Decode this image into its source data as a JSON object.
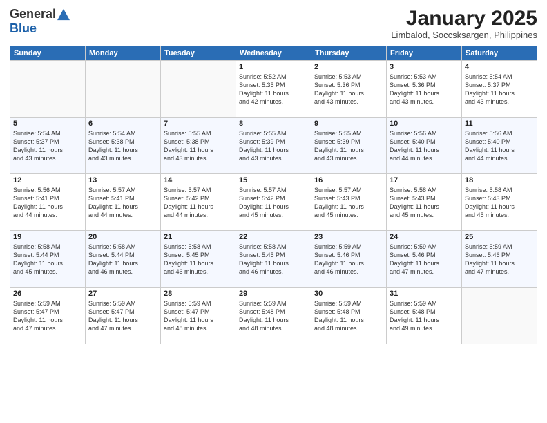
{
  "logo": {
    "general": "General",
    "blue": "Blue"
  },
  "title": "January 2025",
  "location": "Limbalod, Soccsksargen, Philippines",
  "headers": [
    "Sunday",
    "Monday",
    "Tuesday",
    "Wednesday",
    "Thursday",
    "Friday",
    "Saturday"
  ],
  "weeks": [
    [
      {
        "day": "",
        "info": ""
      },
      {
        "day": "",
        "info": ""
      },
      {
        "day": "",
        "info": ""
      },
      {
        "day": "1",
        "info": "Sunrise: 5:52 AM\nSunset: 5:35 PM\nDaylight: 11 hours\nand 42 minutes."
      },
      {
        "day": "2",
        "info": "Sunrise: 5:53 AM\nSunset: 5:36 PM\nDaylight: 11 hours\nand 43 minutes."
      },
      {
        "day": "3",
        "info": "Sunrise: 5:53 AM\nSunset: 5:36 PM\nDaylight: 11 hours\nand 43 minutes."
      },
      {
        "day": "4",
        "info": "Sunrise: 5:54 AM\nSunset: 5:37 PM\nDaylight: 11 hours\nand 43 minutes."
      }
    ],
    [
      {
        "day": "5",
        "info": "Sunrise: 5:54 AM\nSunset: 5:37 PM\nDaylight: 11 hours\nand 43 minutes."
      },
      {
        "day": "6",
        "info": "Sunrise: 5:54 AM\nSunset: 5:38 PM\nDaylight: 11 hours\nand 43 minutes."
      },
      {
        "day": "7",
        "info": "Sunrise: 5:55 AM\nSunset: 5:38 PM\nDaylight: 11 hours\nand 43 minutes."
      },
      {
        "day": "8",
        "info": "Sunrise: 5:55 AM\nSunset: 5:39 PM\nDaylight: 11 hours\nand 43 minutes."
      },
      {
        "day": "9",
        "info": "Sunrise: 5:55 AM\nSunset: 5:39 PM\nDaylight: 11 hours\nand 43 minutes."
      },
      {
        "day": "10",
        "info": "Sunrise: 5:56 AM\nSunset: 5:40 PM\nDaylight: 11 hours\nand 44 minutes."
      },
      {
        "day": "11",
        "info": "Sunrise: 5:56 AM\nSunset: 5:40 PM\nDaylight: 11 hours\nand 44 minutes."
      }
    ],
    [
      {
        "day": "12",
        "info": "Sunrise: 5:56 AM\nSunset: 5:41 PM\nDaylight: 11 hours\nand 44 minutes."
      },
      {
        "day": "13",
        "info": "Sunrise: 5:57 AM\nSunset: 5:41 PM\nDaylight: 11 hours\nand 44 minutes."
      },
      {
        "day": "14",
        "info": "Sunrise: 5:57 AM\nSunset: 5:42 PM\nDaylight: 11 hours\nand 44 minutes."
      },
      {
        "day": "15",
        "info": "Sunrise: 5:57 AM\nSunset: 5:42 PM\nDaylight: 11 hours\nand 45 minutes."
      },
      {
        "day": "16",
        "info": "Sunrise: 5:57 AM\nSunset: 5:43 PM\nDaylight: 11 hours\nand 45 minutes."
      },
      {
        "day": "17",
        "info": "Sunrise: 5:58 AM\nSunset: 5:43 PM\nDaylight: 11 hours\nand 45 minutes."
      },
      {
        "day": "18",
        "info": "Sunrise: 5:58 AM\nSunset: 5:43 PM\nDaylight: 11 hours\nand 45 minutes."
      }
    ],
    [
      {
        "day": "19",
        "info": "Sunrise: 5:58 AM\nSunset: 5:44 PM\nDaylight: 11 hours\nand 45 minutes."
      },
      {
        "day": "20",
        "info": "Sunrise: 5:58 AM\nSunset: 5:44 PM\nDaylight: 11 hours\nand 46 minutes."
      },
      {
        "day": "21",
        "info": "Sunrise: 5:58 AM\nSunset: 5:45 PM\nDaylight: 11 hours\nand 46 minutes."
      },
      {
        "day": "22",
        "info": "Sunrise: 5:58 AM\nSunset: 5:45 PM\nDaylight: 11 hours\nand 46 minutes."
      },
      {
        "day": "23",
        "info": "Sunrise: 5:59 AM\nSunset: 5:46 PM\nDaylight: 11 hours\nand 46 minutes."
      },
      {
        "day": "24",
        "info": "Sunrise: 5:59 AM\nSunset: 5:46 PM\nDaylight: 11 hours\nand 47 minutes."
      },
      {
        "day": "25",
        "info": "Sunrise: 5:59 AM\nSunset: 5:46 PM\nDaylight: 11 hours\nand 47 minutes."
      }
    ],
    [
      {
        "day": "26",
        "info": "Sunrise: 5:59 AM\nSunset: 5:47 PM\nDaylight: 11 hours\nand 47 minutes."
      },
      {
        "day": "27",
        "info": "Sunrise: 5:59 AM\nSunset: 5:47 PM\nDaylight: 11 hours\nand 47 minutes."
      },
      {
        "day": "28",
        "info": "Sunrise: 5:59 AM\nSunset: 5:47 PM\nDaylight: 11 hours\nand 48 minutes."
      },
      {
        "day": "29",
        "info": "Sunrise: 5:59 AM\nSunset: 5:48 PM\nDaylight: 11 hours\nand 48 minutes."
      },
      {
        "day": "30",
        "info": "Sunrise: 5:59 AM\nSunset: 5:48 PM\nDaylight: 11 hours\nand 48 minutes."
      },
      {
        "day": "31",
        "info": "Sunrise: 5:59 AM\nSunset: 5:48 PM\nDaylight: 11 hours\nand 49 minutes."
      },
      {
        "day": "",
        "info": ""
      }
    ]
  ]
}
